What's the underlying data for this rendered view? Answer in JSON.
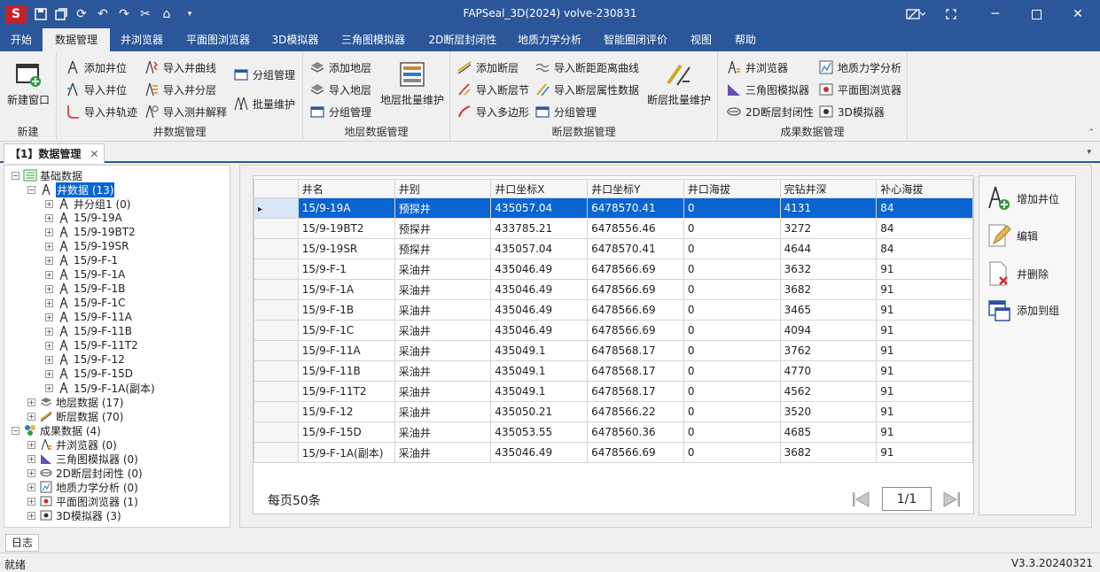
{
  "window": {
    "title": "FAPSeal_3D(2024) volve-230831",
    "accent": "#2b579a"
  },
  "menu": {
    "tabs": [
      "开始",
      "数据管理",
      "井浏览器",
      "平面图浏览器",
      "3D模拟器",
      "三角图模拟器",
      "2D断层封闭性",
      "地质力学分析",
      "智能圈闭评价",
      "视图",
      "帮助"
    ],
    "active": "数据管理"
  },
  "ribbon": {
    "new_group": {
      "label": "新建",
      "new_window": "新建窗口"
    },
    "well_group": {
      "label": "井数据管理",
      "add_well": "添加井位",
      "import_well": "导入井位",
      "import_track": "导入井轨迹",
      "import_curve": "导入井曲线",
      "import_layer": "导入井分层",
      "import_log": "导入测井解释",
      "group_mgmt": "分组管理",
      "batch": "批量维护"
    },
    "layer_group": {
      "label": "地层数据管理",
      "add_layer": "添加地层",
      "import_layer": "导入地层",
      "group_mgmt": "分组管理",
      "batch": "地层批量维护"
    },
    "fault_group": {
      "label": "断层数据管理",
      "add_fault": "添加断层",
      "import_section": "导入断层节",
      "import_polygon": "导入多边形",
      "import_distance": "导入断距距离曲线",
      "import_attr": "导入断层属性数据",
      "group_mgmt": "分组管理",
      "batch": "断层批量维护"
    },
    "result_group": {
      "label": "成果数据管理",
      "well_browser": "井浏览器",
      "triangle": "三角图模拟器",
      "fault2d": "2D断层封闭性",
      "geomech": "地质力学分析",
      "plan": "平面图浏览器",
      "sim3d": "3D模拟器"
    }
  },
  "doc_tab": {
    "label": "【1】数据管理",
    "close": "✕"
  },
  "tree": {
    "base": "基础数据",
    "wells": "井数据 (13)",
    "well_items": [
      "井分组1 (0)",
      "15/9-19A",
      "15/9-19BT2",
      "15/9-19SR",
      "15/9-F-1",
      "15/9-F-1A",
      "15/9-F-1B",
      "15/9-F-1C",
      "15/9-F-11A",
      "15/9-F-11B",
      "15/9-F-11T2",
      "15/9-F-12",
      "15/9-F-15D",
      "15/9-F-1A(副本)"
    ],
    "layers": "地层数据 (17)",
    "faults": "断层数据 (70)",
    "results": "成果数据 (4)",
    "result_items": [
      "井浏览器 (0)",
      "三角图模拟器 (0)",
      "2D断层封闭性 (0)",
      "地质力学分析 (0)",
      "平面图浏览器 (1)",
      "3D模拟器 (3)"
    ]
  },
  "grid": {
    "columns": [
      "井名",
      "井别",
      "井口坐标X",
      "井口坐标Y",
      "井口海拔",
      "完钻井深",
      "补心海拔"
    ],
    "rows": [
      [
        "15/9-19A",
        "预探井",
        "435057.04",
        "6478570.41",
        "0",
        "4131",
        "84"
      ],
      [
        "15/9-19BT2",
        "预探井",
        "433785.21",
        "6478556.46",
        "0",
        "3272",
        "84"
      ],
      [
        "15/9-19SR",
        "预探井",
        "435057.04",
        "6478570.41",
        "0",
        "4644",
        "84"
      ],
      [
        "15/9-F-1",
        "采油井",
        "435046.49",
        "6478566.69",
        "0",
        "3632",
        "91"
      ],
      [
        "15/9-F-1A",
        "采油井",
        "435046.49",
        "6478566.69",
        "0",
        "3682",
        "91"
      ],
      [
        "15/9-F-1B",
        "采油井",
        "435046.49",
        "6478566.69",
        "0",
        "3465",
        "91"
      ],
      [
        "15/9-F-1C",
        "采油井",
        "435046.49",
        "6478566.69",
        "0",
        "4094",
        "91"
      ],
      [
        "15/9-F-11A",
        "采油井",
        "435049.1",
        "6478568.17",
        "0",
        "3762",
        "91"
      ],
      [
        "15/9-F-11B",
        "采油井",
        "435049.1",
        "6478568.17",
        "0",
        "4770",
        "91"
      ],
      [
        "15/9-F-11T2",
        "采油井",
        "435049.1",
        "6478568.17",
        "0",
        "4562",
        "91"
      ],
      [
        "15/9-F-12",
        "采油井",
        "435050.21",
        "6478566.22",
        "0",
        "3520",
        "91"
      ],
      [
        "15/9-F-15D",
        "采油井",
        "435053.55",
        "6478560.36",
        "0",
        "4685",
        "91"
      ],
      [
        "15/9-F-1A(副本)",
        "采油井",
        "435046.49",
        "6478566.69",
        "0",
        "3682",
        "91"
      ]
    ],
    "selected_row": 0
  },
  "pager": {
    "page_size": "每页50条",
    "page": "1/1"
  },
  "actions": {
    "add": "增加井位",
    "edit": "编辑",
    "delete": "井删除",
    "add_group": "添加到组"
  },
  "log_tab": "日志",
  "status": {
    "left": "就绪",
    "version": "V3.3.20240321"
  }
}
